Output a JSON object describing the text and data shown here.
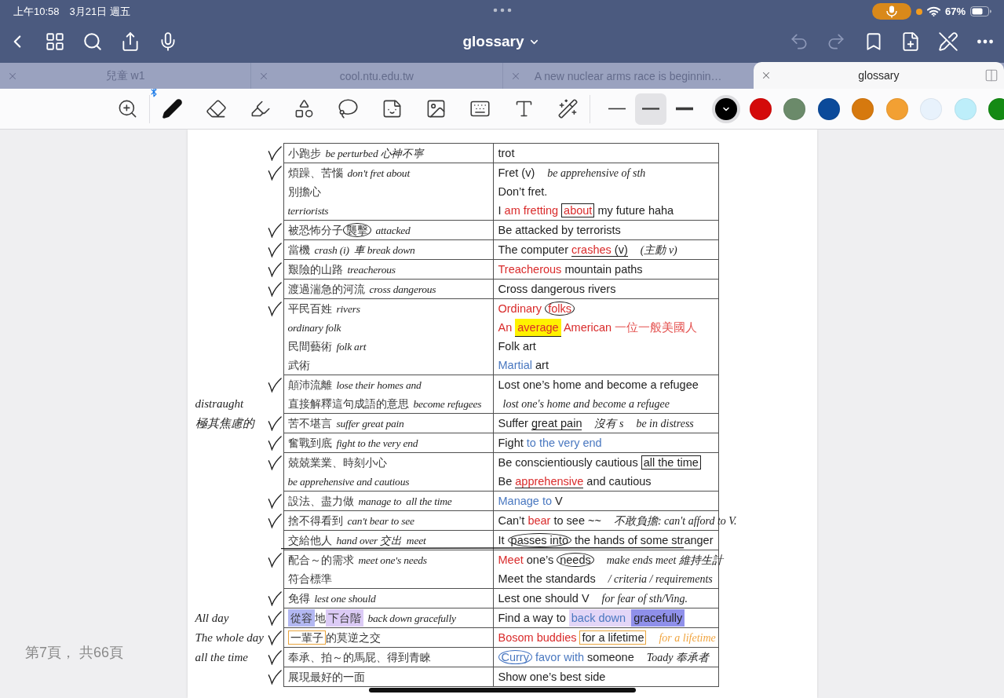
{
  "status_bar": {
    "time": "上午10:58",
    "date": "3月21日 週五",
    "battery": "67%",
    "mic_active": true
  },
  "nav": {
    "title": "glossary",
    "undo": {
      "disabled": true
    },
    "redo": {
      "disabled": true
    }
  },
  "tabs": [
    {
      "label": "兒童 w1",
      "selected": false
    },
    {
      "label": "cool.ntu.edu.tw",
      "selected": false
    },
    {
      "label": "A new nuclear arms race is beginnin…",
      "selected": false
    },
    {
      "label": "glossary",
      "selected": true
    }
  ],
  "toolbar": {
    "stylus_connected": true,
    "tools": [
      {
        "kind": "zoom",
        "selected": false
      },
      {
        "kind": "pen",
        "selected": true
      },
      {
        "kind": "eraser",
        "selected": false
      },
      {
        "kind": "highlighter",
        "selected": false
      },
      {
        "kind": "shapes",
        "selected": false
      },
      {
        "kind": "lasso",
        "selected": false
      },
      {
        "kind": "elements",
        "selected": false
      },
      {
        "kind": "image",
        "selected": false
      },
      {
        "kind": "keyboard",
        "selected": false
      },
      {
        "kind": "text",
        "selected": false
      },
      {
        "kind": "laser",
        "selected": false
      }
    ],
    "stroke_widths": [
      {
        "selected": false
      },
      {
        "selected": true
      },
      {
        "selected": false
      }
    ],
    "colors": [
      {
        "color": "#000000",
        "selected": true
      },
      {
        "color": "#d40a0a",
        "selected": false
      },
      {
        "color": "#6b8a6a",
        "selected": false
      },
      {
        "color": "#0b4a9a",
        "selected": false
      },
      {
        "color": "#d6790e",
        "selected": false
      },
      {
        "color": "#f2a033",
        "selected": false
      },
      {
        "color": "#e8f2fc",
        "selected": false
      },
      {
        "color": "#bdeefa",
        "selected": false
      },
      {
        "color": "#148a14",
        "selected": false
      }
    ]
  },
  "page": {
    "indicator": "第7頁， 共66頁",
    "rows": [
      {
        "checked": true,
        "struck": false,
        "lines": [
          {
            "left": [
              {
                "kind": "typed",
                "text": "小跑步"
              },
              {
                "kind": "hand",
                "text": "be perturbed 心神不寧"
              }
            ],
            "right": [
              {
                "kind": "typed",
                "text": "trot"
              }
            ]
          }
        ]
      },
      {
        "checked": true,
        "struck": false,
        "lines": [
          {
            "left": [
              {
                "kind": "typed",
                "text": "煩躁、苦惱"
              },
              {
                "kind": "hand",
                "text": "don't fret about"
              }
            ],
            "right": [
              {
                "kind": "typed",
                "text": "Fret (v)"
              },
              {
                "kind": "hand",
                "text": "be apprehensive of sth"
              }
            ]
          },
          {
            "left": [
              {
                "kind": "typed",
                "text": "別擔心"
              }
            ],
            "right": [
              {
                "kind": "typed",
                "text": "Don’t fret."
              }
            ]
          },
          {
            "left": [
              {
                "kind": "hand",
                "text": "terriorists"
              }
            ],
            "right": [
              {
                "kind": "typed",
                "text": "I "
              },
              {
                "kind": "typed",
                "text": "am fretting ",
                "color": "#d92b2b"
              },
              {
                "kind": "typed",
                "text": "about",
                "color": "#d92b2b",
                "boxed": true
              },
              {
                "kind": "typed",
                "text": " my future haha"
              }
            ]
          }
        ]
      },
      {
        "checked": true,
        "struck": false,
        "lines": [
          {
            "left": [
              {
                "kind": "typed",
                "text": "被恐怖分子"
              },
              {
                "kind": "typed",
                "text": "襲擊",
                "circled": true
              },
              {
                "kind": "hand",
                "text": "attacked"
              }
            ],
            "right": [
              {
                "kind": "typed",
                "text": "Be attacked by terrorists"
              }
            ]
          }
        ]
      },
      {
        "checked": true,
        "struck": false,
        "lines": [
          {
            "left": [
              {
                "kind": "typed",
                "text": "當機"
              },
              {
                "kind": "hand",
                "text": "crash (i)"
              },
              {
                "kind": "hand",
                "text": "車 break down"
              }
            ],
            "right": [
              {
                "kind": "typed",
                "text": "The computer "
              },
              {
                "kind": "typed",
                "text": "crashes",
                "color": "#d92b2b",
                "underlined": true
              },
              {
                "kind": "typed",
                "text": " (v)",
                "underlined": true
              },
              {
                "kind": "hand",
                "text": "(主動 v)"
              }
            ]
          }
        ]
      },
      {
        "checked": true,
        "struck": false,
        "lines": [
          {
            "left": [
              {
                "kind": "typed",
                "text": "艱險的山路"
              },
              {
                "kind": "hand",
                "text": "treacherous"
              }
            ],
            "right": [
              {
                "kind": "typed",
                "text": "Treacherous",
                "color": "#d92b2b"
              },
              {
                "kind": "typed",
                "text": " mountain paths"
              }
            ]
          }
        ]
      },
      {
        "checked": true,
        "struck": false,
        "lines": [
          {
            "left": [
              {
                "kind": "typed",
                "text": "渡過湍急的河流"
              },
              {
                "kind": "hand",
                "text": "cross dangerous"
              }
            ],
            "right": [
              {
                "kind": "typed",
                "text": "Cross dangerous rivers"
              }
            ]
          }
        ]
      },
      {
        "checked": true,
        "struck": false,
        "lines": [
          {
            "left": [
              {
                "kind": "typed",
                "text": "平民百姓"
              },
              {
                "kind": "hand",
                "text": "rivers"
              }
            ],
            "right": [
              {
                "kind": "typed",
                "text": "Ordinary ",
                "color": "#d92b2b"
              },
              {
                "kind": "typed",
                "text": "folks",
                "color": "#d92b2b",
                "circled": true
              }
            ]
          },
          {
            "left": [
              {
                "kind": "hand",
                "text": "ordinary folk"
              }
            ],
            "right": [
              {
                "kind": "typed",
                "text": "An ",
                "color": "#d92b2b"
              },
              {
                "kind": "typed",
                "text": "average",
                "color": "#d92b2b",
                "highlight": {
                  "color": "#fff200"
                },
                "underlined": true
              },
              {
                "kind": "typed",
                "text": " American ",
                "color": "#d92b2b"
              },
              {
                "kind": "typed",
                "text": "一位一般美國人",
                "color": "#e4514f"
              }
            ]
          },
          {
            "left": [
              {
                "kind": "typed",
                "text": "民間藝術"
              },
              {
                "kind": "hand",
                "text": "folk art"
              }
            ],
            "right": [
              {
                "kind": "typed",
                "text": "Folk art"
              }
            ]
          },
          {
            "left": [
              {
                "kind": "typed",
                "text": "武術"
              }
            ],
            "right": [
              {
                "kind": "typed",
                "text": "Martial",
                "color": "#4a78c0"
              },
              {
                "kind": "typed",
                "text": " art"
              }
            ]
          }
        ]
      },
      {
        "checked": true,
        "struck": false,
        "lines": [
          {
            "left": [
              {
                "kind": "typed",
                "text": "顛沛流離"
              },
              {
                "kind": "hand",
                "text": "lose their homes and"
              }
            ],
            "right": [
              {
                "kind": "typed",
                "text": "Lost one’s home and become a refugee"
              }
            ]
          },
          {
            "margin": "distraught",
            "left": [
              {
                "kind": "typed",
                "text": "直接解釋這句成語的意思"
              },
              {
                "kind": "hand",
                "text": "become refugees"
              }
            ],
            "right": [
              {
                "kind": "hand",
                "text": "lost one's home and become a refugee"
              }
            ]
          }
        ]
      },
      {
        "checked": true,
        "struck": false,
        "lines": [
          {
            "margin": "極其焦慮的",
            "left": [
              {
                "kind": "typed",
                "text": "苦不堪言"
              },
              {
                "kind": "hand",
                "text": "suffer great pain"
              }
            ],
            "right": [
              {
                "kind": "typed",
                "text": "Suffer "
              },
              {
                "kind": "typed",
                "text": "great pain",
                "underlined": true
              },
              {
                "kind": "hand",
                "text": "沒有 s"
              },
              {
                "kind": "hand",
                "text": "be in distress"
              }
            ]
          }
        ]
      },
      {
        "checked": true,
        "struck": false,
        "lines": [
          {
            "left": [
              {
                "kind": "typed",
                "text": "奮戰到底"
              },
              {
                "kind": "hand",
                "text": "fight to the very end"
              }
            ],
            "right": [
              {
                "kind": "typed",
                "text": "Fight "
              },
              {
                "kind": "typed",
                "text": "to the very end",
                "color": "#4a78c0"
              }
            ]
          }
        ]
      },
      {
        "checked": true,
        "struck": false,
        "lines": [
          {
            "left": [
              {
                "kind": "typed",
                "text": "兢兢業業、時刻小心"
              }
            ],
            "right": [
              {
                "kind": "typed",
                "text": "Be conscientiously cautious "
              },
              {
                "kind": "typed",
                "text": "all the time",
                "boxed": true
              }
            ]
          },
          {
            "left": [
              {
                "kind": "hand",
                "text": "be apprehensive and cautious"
              }
            ],
            "right": [
              {
                "kind": "typed",
                "text": "Be "
              },
              {
                "kind": "typed",
                "text": "apprehensive",
                "color": "#d92b2b",
                "underlined": true
              },
              {
                "kind": "typed",
                "text": " and cautious"
              }
            ]
          }
        ]
      },
      {
        "checked": true,
        "struck": false,
        "lines": [
          {
            "left": [
              {
                "kind": "typed",
                "text": "設法、盡力做"
              },
              {
                "kind": "hand",
                "text": "manage to"
              },
              {
                "kind": "hand",
                "text": "all the time"
              }
            ],
            "right": [
              {
                "kind": "typed",
                "text": "Manage to",
                "color": "#4a78c0"
              },
              {
                "kind": "typed",
                "text": " V"
              }
            ]
          }
        ]
      },
      {
        "checked": true,
        "struck": false,
        "lines": [
          {
            "left": [
              {
                "kind": "typed",
                "text": "捨不得看到"
              },
              {
                "kind": "hand",
                "text": "can't bear to see"
              }
            ],
            "right": [
              {
                "kind": "typed",
                "text": "Can’t "
              },
              {
                "kind": "typed",
                "text": "bear",
                "color": "#d92b2b"
              },
              {
                "kind": "typed",
                "text": " to see ~~"
              },
              {
                "kind": "hand",
                "text": "不敢負擔: can't afford to V."
              }
            ]
          }
        ]
      },
      {
        "checked": false,
        "struck": true,
        "lines": [
          {
            "left": [
              {
                "kind": "typed",
                "text": "交給他人"
              },
              {
                "kind": "hand",
                "text": "hand over 交出"
              },
              {
                "kind": "hand",
                "text": "meet"
              }
            ],
            "right": [
              {
                "kind": "typed",
                "text": "It "
              },
              {
                "kind": "typed",
                "text": "passes into",
                "circled": true
              },
              {
                "kind": "typed",
                "text": " the hands of some stranger"
              }
            ]
          }
        ]
      },
      {
        "checked": true,
        "struck": false,
        "lines": [
          {
            "left": [
              {
                "kind": "typed",
                "text": "配合～的需求"
              },
              {
                "kind": "hand",
                "text": "meet one's needs"
              }
            ],
            "right": [
              {
                "kind": "typed",
                "text": "Meet",
                "color": "#d92b2b"
              },
              {
                "kind": "typed",
                "text": " one’s "
              },
              {
                "kind": "typed",
                "text": "needs",
                "circled": true
              },
              {
                "kind": "hand",
                "text": "make ends meet 維持生計"
              }
            ]
          },
          {
            "left": [
              {
                "kind": "typed",
                "text": "符合標準"
              }
            ],
            "right": [
              {
                "kind": "typed",
                "text": "Meet the standards"
              },
              {
                "kind": "hand",
                "text": "/ criteria / requirements"
              }
            ]
          }
        ]
      },
      {
        "checked": true,
        "struck": false,
        "lines": [
          {
            "left": [
              {
                "kind": "typed",
                "text": "免得"
              },
              {
                "kind": "hand",
                "text": "lest one should"
              }
            ],
            "right": [
              {
                "kind": "typed",
                "text": "Lest one should V"
              },
              {
                "kind": "hand",
                "text": "for fear of sth/Ving."
              }
            ]
          }
        ]
      },
      {
        "checked": true,
        "struck": false,
        "lines": [
          {
            "margin": "All day",
            "left": [
              {
                "kind": "typed",
                "text": "從容",
                "highlight": {
                  "color": "#b3b8f2"
                }
              },
              {
                "kind": "typed",
                "text": "地"
              },
              {
                "kind": "typed",
                "text": "下台階",
                "highlight": {
                  "color": "#dccbf6"
                }
              },
              {
                "kind": "hand",
                "text": "back down gracefully"
              }
            ],
            "right": [
              {
                "kind": "typed",
                "text": "Find a way to "
              },
              {
                "kind": "typed",
                "text": "back down ",
                "color": "#4a78c0",
                "highlight": {
                  "color": "#e3d6f7"
                }
              },
              {
                "kind": "typed",
                "text": "gracefully",
                "highlight": {
                  "color": "#8f90ea"
                }
              }
            ]
          }
        ]
      },
      {
        "checked": true,
        "struck": false,
        "lines": [
          {
            "margin": "The whole day",
            "left": [
              {
                "kind": "typed",
                "text": "一輩子",
                "boxed": true,
                "mark_ink": {
                  "color": "#e9a43c"
                }
              },
              {
                "kind": "typed",
                "text": "的莫逆之交"
              }
            ],
            "right": [
              {
                "kind": "typed",
                "text": "Bosom buddies ",
                "color": "#d92b2b"
              },
              {
                "kind": "typed",
                "text": "for a lifetime",
                "boxed": true,
                "mark_ink": {
                  "color": "#e9a43c"
                }
              },
              {
                "kind": "hand",
                "text": "for a lifetime",
                "color": "#f0a541"
              }
            ]
          }
        ]
      },
      {
        "checked": true,
        "struck": false,
        "lines": [
          {
            "margin": "all the time",
            "left": [
              {
                "kind": "typed",
                "text": "奉承、拍～的馬屁、得到青睞"
              }
            ],
            "right": [
              {
                "kind": "typed",
                "text": "Curry",
                "color": "#4a78c0",
                "circled": true,
                "mark_ink": {
                  "color": "#3d6fc0"
                }
              },
              {
                "kind": "typed",
                "text": " favor with",
                "color": "#4a78c0"
              },
              {
                "kind": "typed",
                "text": " someone"
              },
              {
                "kind": "hand",
                "text": "Toady 奉承者"
              }
            ]
          }
        ]
      },
      {
        "checked": true,
        "struck": false,
        "lines": [
          {
            "left": [
              {
                "kind": "typed",
                "text": "展現最好的一面"
              }
            ],
            "right": [
              {
                "kind": "typed",
                "text": "Show one’s best side"
              }
            ]
          }
        ]
      }
    ]
  }
}
